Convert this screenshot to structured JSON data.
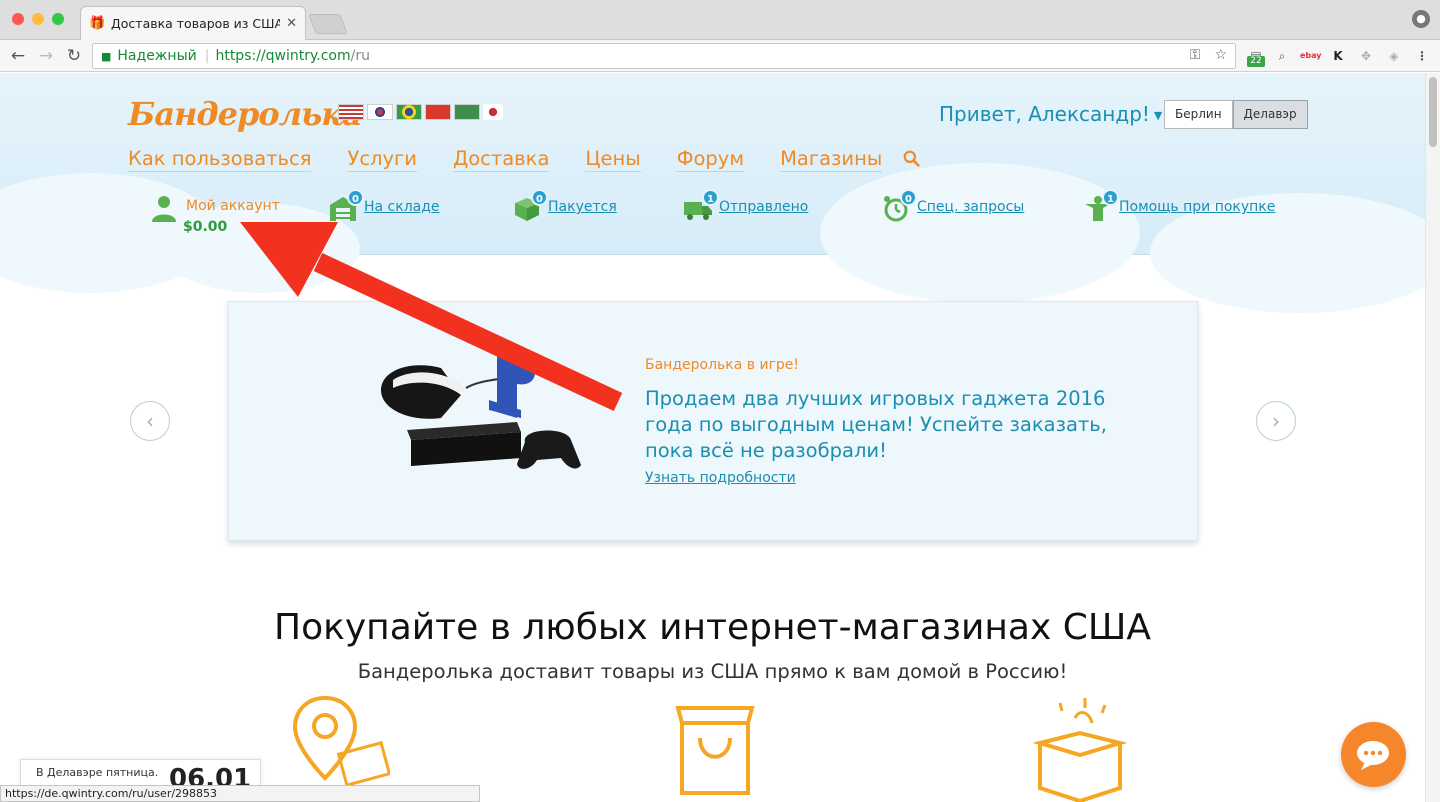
{
  "browser": {
    "tab_title": "Доставка товаров из США. То",
    "omnibox": {
      "secure_label": "Надежный",
      "url_host": "https://qwintry.com",
      "url_path": "/ru"
    },
    "ext_badge": "22",
    "status_url": "https://de.qwintry.com/ru/user/298853"
  },
  "header": {
    "logo": "Бандеролька",
    "greeting": "Привет, Александр!",
    "warehouses": [
      "Берлин",
      "Делавэр"
    ]
  },
  "nav": [
    "Как пользоваться",
    "Услуги",
    "Доставка",
    "Цены",
    "Форум",
    "Магазины"
  ],
  "account": {
    "label": "Мой аккаунт",
    "balance": "$0.00"
  },
  "statuses": [
    {
      "label": "На складе",
      "count": "0"
    },
    {
      "label": "Пакуется",
      "count": "0"
    },
    {
      "label": "Отправлено",
      "count": "1"
    },
    {
      "label": "Спец. запросы",
      "count": "0"
    },
    {
      "label": "Помощь при покупке",
      "count": "1"
    }
  ],
  "promo": {
    "eyebrow": "Бандеролька в игре!",
    "text": "Продаем два лучших игровых гаджета 2016 года по выгодным ценам! Успейте заказать, пока всё не разобрали!",
    "link": "Узнать подробности"
  },
  "hero": {
    "title": "Покупайте в любых интернет-магазинах США",
    "subtitle": "Бандеролька доставит товары из США прямо к вам домой в Россию!"
  },
  "clock": {
    "text": "В Делавэре пятница.",
    "date": "06.01"
  },
  "colors": {
    "accent_orange": "#f08a24",
    "link_blue": "#1b8fb2",
    "balance_green": "#2d9c3a",
    "badge_blue": "#2a9fd0",
    "arrow_red": "#f2321f"
  }
}
